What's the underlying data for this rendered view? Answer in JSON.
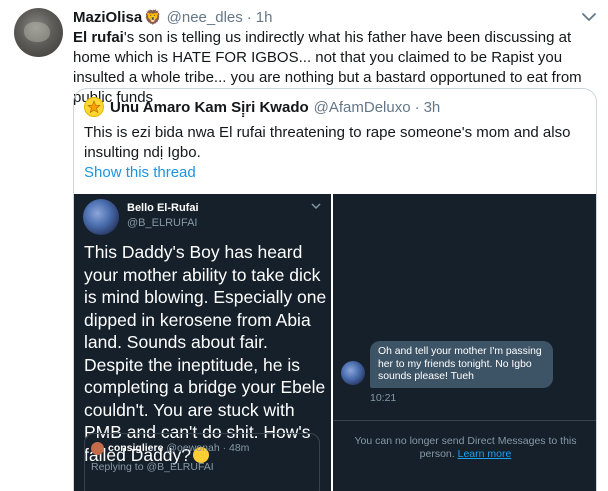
{
  "tweet": {
    "name": "MaziOlisa",
    "name_emoji": "🦁",
    "handle": "@nee_dles",
    "separator": "·",
    "time": "1h",
    "text_bold": "El rufai",
    "text_rest": "'s son is telling us indirectly what his father have been discussing at home which is HATE FOR IGBOS... not that you claimed to be Rapist you insulted a whole tribe... you are nothing but a bastard opportuned to eat from public funds"
  },
  "quote": {
    "name": "Unu Amaro Kam Sị̣ri Kwado",
    "handle": "@AfamDeluxo",
    "separator": "·",
    "time": "3h",
    "text": "This is ezi bida nwa El rufai threatening to rape someone's mom and also insulting ndị Igbo.",
    "show_thread": "Show this thread"
  },
  "screenshot_left": {
    "name": "Bello El-Rufai",
    "handle": "@B_ELRUFAI",
    "text": "This Daddy's Boy has heard your mother ability to take dick is mind blowing. Especially one dipped in kerosene from Abia land. Sounds about fair. Despite the ineptitude, he is completing a bridge your Ebele couldn't. You are stuck with PMB and can't do shit. How's failed Daddy?",
    "card_name": "consigliere",
    "card_handle": "@oewonah · 48m",
    "card_reply": "Replying to @B_ELRUFAI"
  },
  "screenshot_right": {
    "message": "Oh and tell your mother I'm passing her to my friends tonight. No Igbo sounds please! Tueh",
    "time": "10:21",
    "notice": "You can no longer send Direct Messages to this person.",
    "learn_more": "Learn more"
  },
  "colors": {
    "link": "#1b95e0",
    "muted": "#657786",
    "dark_bg": "#15202b",
    "bubble": "#3d5466"
  },
  "icons": {
    "caret": "chevron-down-icon",
    "quote_avatar": "yellow-star-avatar"
  }
}
